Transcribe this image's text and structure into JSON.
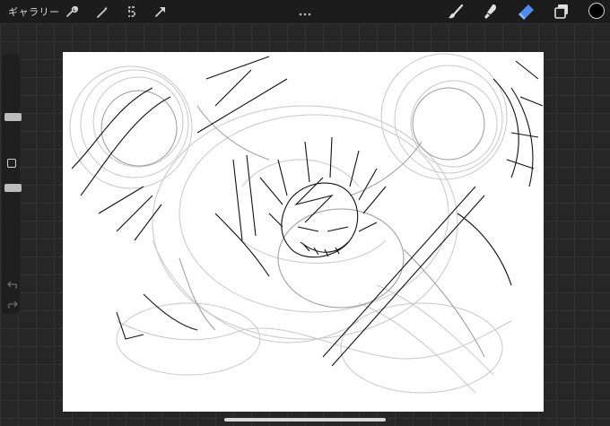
{
  "toolbar": {
    "gallery_label": "ギャラリー",
    "left_icons": [
      "wrench-icon",
      "magic-wand-icon",
      "selection-s-icon",
      "transform-arrow-icon"
    ],
    "right_icons": [
      "brush-icon",
      "smudge-icon",
      "eraser-icon",
      "layers-icon"
    ],
    "active_tool": "eraser",
    "active_tool_color": "#4a8cf0",
    "current_color": "#000000"
  },
  "sidebar": {
    "brush_size_level": 0.25,
    "opacity_level": 0.55
  },
  "canvas": {
    "background_color": "#ffffff"
  }
}
